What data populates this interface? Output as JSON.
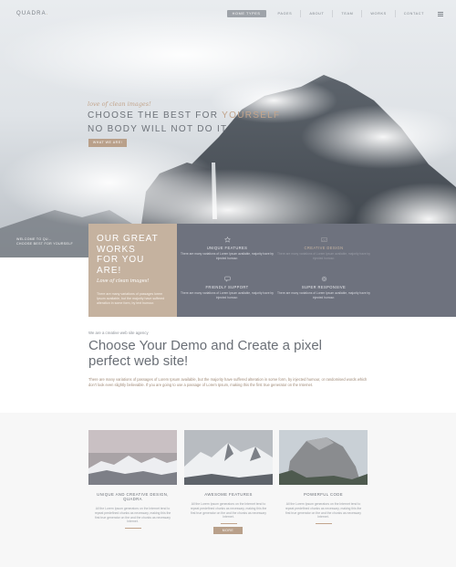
{
  "brand": {
    "name_main": "QUADRA",
    "name_accent": "."
  },
  "nav": {
    "items": [
      {
        "label": "HOME TYPES",
        "active": true
      },
      {
        "label": "PAGES",
        "active": false
      },
      {
        "label": "ABOUT",
        "active": false
      },
      {
        "label": "TEAM",
        "active": false
      },
      {
        "label": "WORKS",
        "active": false
      },
      {
        "label": "CONTACT",
        "active": false
      }
    ],
    "menu_icon": "hamburger-icon"
  },
  "hero": {
    "tagline": "love of clean images!",
    "headline_part1": "CHOOSE THE BEST FOR ",
    "headline_accent": "YOURSELF",
    "headline_line2": "NO BODY WILL NOT DO IT",
    "button_label": "WHAT WE ARE!",
    "welcome_line1": "WELCOME TO QU...",
    "welcome_line2": "CHOOSE BEST FOR YOURSELF"
  },
  "feature_intro": {
    "title_lines": [
      "OUR GREAT",
      "WORKS",
      "FOR YOU ARE!"
    ],
    "subtitle": "Love of clean images!",
    "text": "There are many variations of passages lorem Ipsum available, but the majority have suffered alteration in some form, by text humour."
  },
  "features": [
    {
      "icon": "star-icon",
      "title": "UNIQUE FEATURES",
      "text": "There are many variations of Lorem Ipsum available, majority have by injected humour.",
      "highlight": false
    },
    {
      "icon": "image-icon",
      "title": "CREATIVE DESIGN",
      "text": "There are many variations of Lorem Ipsum available, majority have by injected humour.",
      "highlight": true
    },
    {
      "icon": "chat-icon",
      "title": "FRIENDLY SUPPORT",
      "text": "There are many variations of Lorem Ipsum available, majority have by injected humour.",
      "highlight": false
    },
    {
      "icon": "settings-icon",
      "title": "SUPER RESPONSIVE",
      "text": "There are many variations of Lorem Ipsum available, majority have by injected humour.",
      "highlight": false
    }
  ],
  "intro": {
    "kicker": "We are a creative web site agency",
    "heading": "Choose Your Demo and Create a pixel perfect web site!",
    "paragraph": "There are many variations of passages of Lorem Ipsum available, but the majority have suffered alteration in some form, by injected humour, or randomised words which don't look even slightly believable. If you are going to use a passage of Lorem Ipsum, making this the first true generator on the Internet."
  },
  "cards": [
    {
      "title": "UNIQUE AND CREATIVE DESIGN, QUADRA",
      "text": "All the Lorem Ipsum generators on the Internet tend to repeat predefined chunks as necessary, making this the first true generator on the and the chunks as necessary Internet."
    },
    {
      "title": "AWESOME FEATURES",
      "text": "All the Lorem Ipsum generators on the Internet tend to repeat predefined chunks as necessary, making this the first true generator on the and the chunks as necessary Internet."
    },
    {
      "title": "POWERFUL CODE",
      "text": "All the Lorem Ipsum generators on the Internet tend to repeat predefined chunks as necessary, making this the first true generator on the and the chunks as necessary Internet."
    }
  ],
  "more_button": "MORE",
  "colors": {
    "accent": "#c2a58d",
    "tan_box": "#c5b29f",
    "slate_box": "#6e727e",
    "text_dark": "#6a6f76"
  }
}
